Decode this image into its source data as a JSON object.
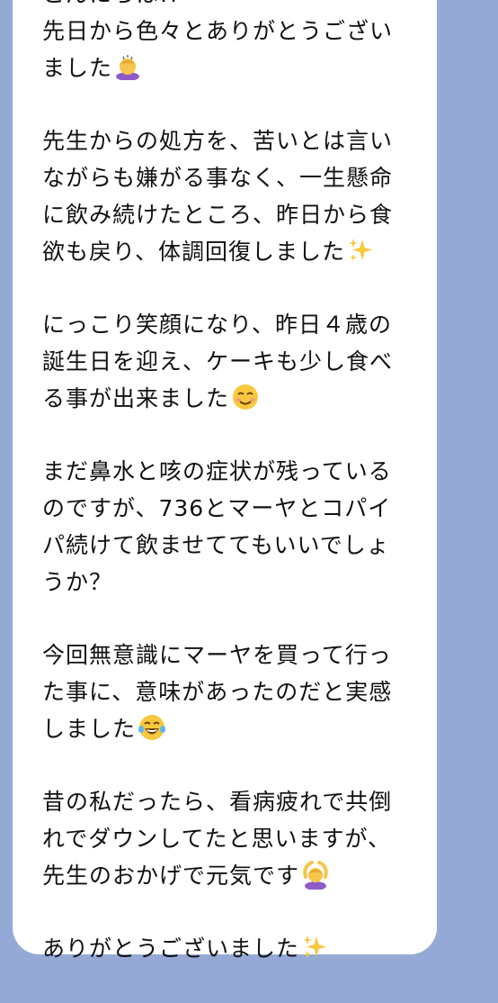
{
  "message": {
    "paragraphs": [
      {
        "lines": [
          "こんにちは!!",
          "先日から色々とありがとうござい",
          "ました"
        ],
        "emoji": "bowing-woman-icon"
      },
      {
        "lines": [
          "先生からの処方を、苦いとは言い",
          "ながらも嫌がる事なく、一生懸命",
          "に飲み続けたところ、昨日から食",
          "欲も戻り、体調回復しました"
        ],
        "emoji": "sparkles-icon"
      },
      {
        "lines": [
          "にっこり笑顔になり、昨日４歳の",
          "誕生日を迎え、ケーキも少し食べ",
          "る事が出来ました"
        ],
        "emoji": "smiling-face-icon"
      },
      {
        "lines": [
          "まだ鼻水と咳の症状が残っている",
          "のですが、736とマーヤとコパイ",
          "パ続けて飲ませててもいいでしょ",
          "うか？"
        ],
        "emoji": ""
      },
      {
        "lines": [
          "今回無意識にマーヤを買って行っ",
          "た事に、意味があったのだと実感",
          "しました"
        ],
        "emoji": "tears-of-joy-icon"
      },
      {
        "lines": [
          "昔の私だったら、看病疲れで共倒",
          "れでダウンしてたと思いますが、",
          "先生のおかげで元気です"
        ],
        "emoji": "woman-ok-gesture-icon"
      },
      {
        "lines": [
          "ありがとうございました"
        ],
        "emoji": "sparkles-icon"
      }
    ]
  },
  "colors": {
    "chat_background": "#94a9d6",
    "bubble": "#ffffff",
    "text": "#111111"
  }
}
